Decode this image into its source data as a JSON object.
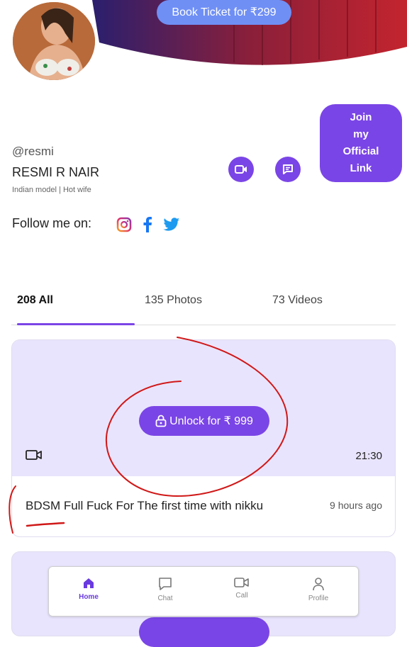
{
  "header": {
    "book_ticket_label": "Book Ticket for ₹299"
  },
  "profile": {
    "handle": "@resmi",
    "name": "RESMI R NAIR",
    "bio": "Indian model | Hot wife",
    "join_label_lines": [
      "Join",
      "my",
      "Official",
      "Link"
    ],
    "follow_label": "Follow me on:"
  },
  "tabs": [
    {
      "label": "208 All",
      "active": true
    },
    {
      "label": "135 Photos",
      "active": false
    },
    {
      "label": "73 Videos",
      "active": false
    }
  ],
  "post": {
    "unlock_label": "Unlock for ₹ 999",
    "duration": "21:30",
    "title": "BDSM Full Fuck For The first time with nikku",
    "time_ago": "9 hours ago"
  },
  "nav": {
    "home": "Home",
    "chat": "Chat",
    "call": "Call",
    "profile": "Profile"
  },
  "colors": {
    "accent": "#7a45e6",
    "ticket": "#6f8ff5",
    "card_bg": "#e9e4fd",
    "annotation": "#d01818"
  },
  "icons": [
    "video-icon",
    "chat-icon",
    "instagram-icon",
    "facebook-icon",
    "twitter-icon",
    "lock-icon",
    "home-icon",
    "user-icon"
  ]
}
